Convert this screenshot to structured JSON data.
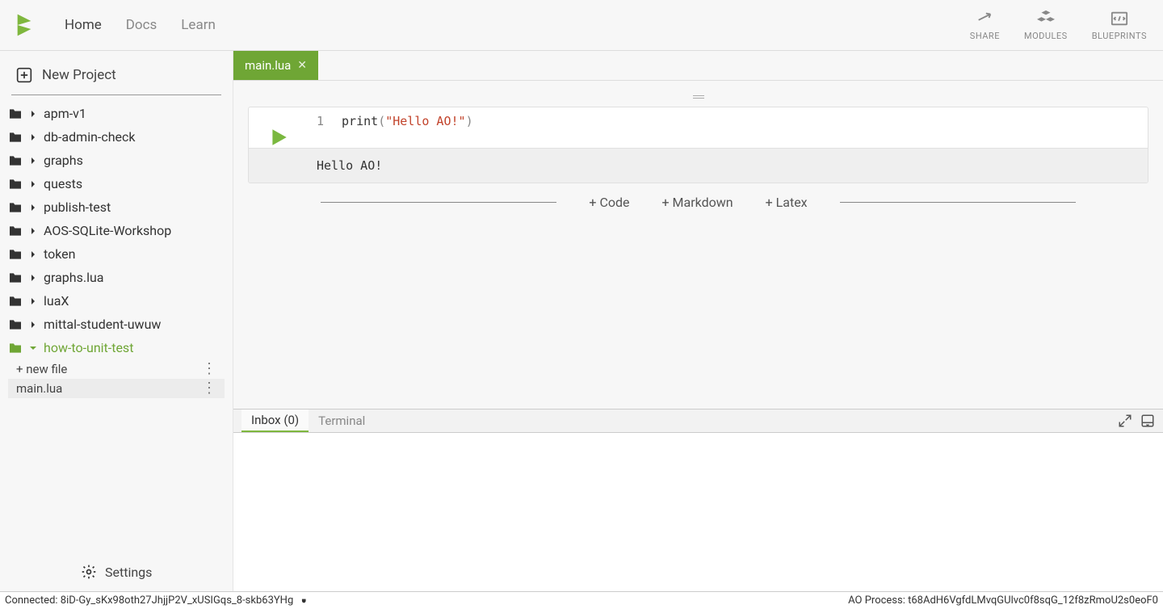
{
  "header": {
    "nav": [
      "Home",
      "Docs",
      "Learn"
    ],
    "active_nav": 0,
    "actions": [
      {
        "label": "SHARE",
        "icon": "share-icon"
      },
      {
        "label": "MODULES",
        "icon": "modules-icon"
      },
      {
        "label": "BLUEPRINTS",
        "icon": "blueprints-icon"
      }
    ]
  },
  "sidebar": {
    "new_project": "New Project",
    "projects": [
      {
        "name": "apm-v1"
      },
      {
        "name": "db-admin-check"
      },
      {
        "name": "graphs"
      },
      {
        "name": "quests"
      },
      {
        "name": "publish-test"
      },
      {
        "name": "AOS-SQLite-Workshop"
      },
      {
        "name": "token"
      },
      {
        "name": "graphs.lua"
      },
      {
        "name": "luaX"
      },
      {
        "name": "mittal-student-uwuw"
      }
    ],
    "active_project": "how-to-unit-test",
    "new_file": "+ new file",
    "active_file": "main.lua",
    "settings": "Settings"
  },
  "editor": {
    "tab": {
      "name": "main.lua"
    },
    "cell": {
      "line_num": "1",
      "code": {
        "fn": "print",
        "str": "\"Hello AO!\""
      },
      "output": "Hello AO!"
    },
    "add": {
      "code": "+ Code",
      "markdown": "+ Markdown",
      "latex": "+ Latex"
    }
  },
  "panel": {
    "tabs": {
      "inbox": "Inbox (0)",
      "terminal": "Terminal"
    }
  },
  "status": {
    "connected": "Connected: 8iD-Gy_sKx98oth27JhjjP2V_xUSIGqs_8-skb63YHg",
    "process": "AO Process: t68AdH6VgfdLMvqGUlvc0f8sqG_12f8zRmoU2s0eoF0"
  }
}
